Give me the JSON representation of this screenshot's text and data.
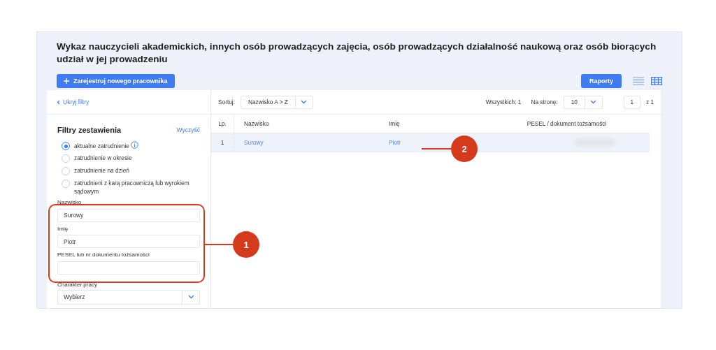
{
  "header": {
    "title": "Wykaz nauczycieli akademickich, innych osób prowadzących zajęcia, osób prowadzących działalność naukową oraz osób biorących udział w jej prowadzeniu",
    "register_button": "Zarejestruj nowego pracownika",
    "reports_button": "Raporty",
    "view_modes": [
      {
        "kind": "list",
        "selected": false
      },
      {
        "kind": "grid",
        "selected": true
      }
    ]
  },
  "filters": {
    "hide_link": "Ukryj filtry",
    "title": "Filtry zestawienia",
    "clear_link": "Wyczyść",
    "radios": [
      {
        "label": "aktualne zatrudnienie",
        "selected": true,
        "info": true
      },
      {
        "label": "zatrudnienie w okresie",
        "selected": false,
        "info": false
      },
      {
        "label": "zatrudnienie na dzień",
        "selected": false,
        "info": false
      },
      {
        "label": "zatrudnieni z karą pracowniczą lub wyrokiem sądowym",
        "selected": false,
        "info": false
      }
    ],
    "fields": [
      {
        "label": "Nazwisko",
        "value": "Surowy"
      },
      {
        "label": "Imię",
        "value": "Piotr"
      },
      {
        "label": "PESEL lub nr dokumentu tożsamości"
      }
    ],
    "select": {
      "label": "Charakter pracy",
      "value": "Wybierz"
    }
  },
  "toolbar": {
    "sort_label": "Sortuj:",
    "sort_value": "Nazwisko A > Z",
    "total": "Wszystkich: 1",
    "per_page_label": "Na stronę:",
    "per_page_value": "10",
    "page": "1",
    "page_of": "z 1"
  },
  "table": {
    "columns": [
      "Lp.",
      "Nazwisko",
      "Imię",
      "PESEL / dokument tożsamości"
    ],
    "rows": [
      {
        "number": "1",
        "surname": "Surowy",
        "name": "Piotr",
        "selected": true,
        "id_redacted": true
      }
    ]
  },
  "annotations": [
    {
      "label": "1"
    },
    {
      "label": "2"
    }
  ]
}
